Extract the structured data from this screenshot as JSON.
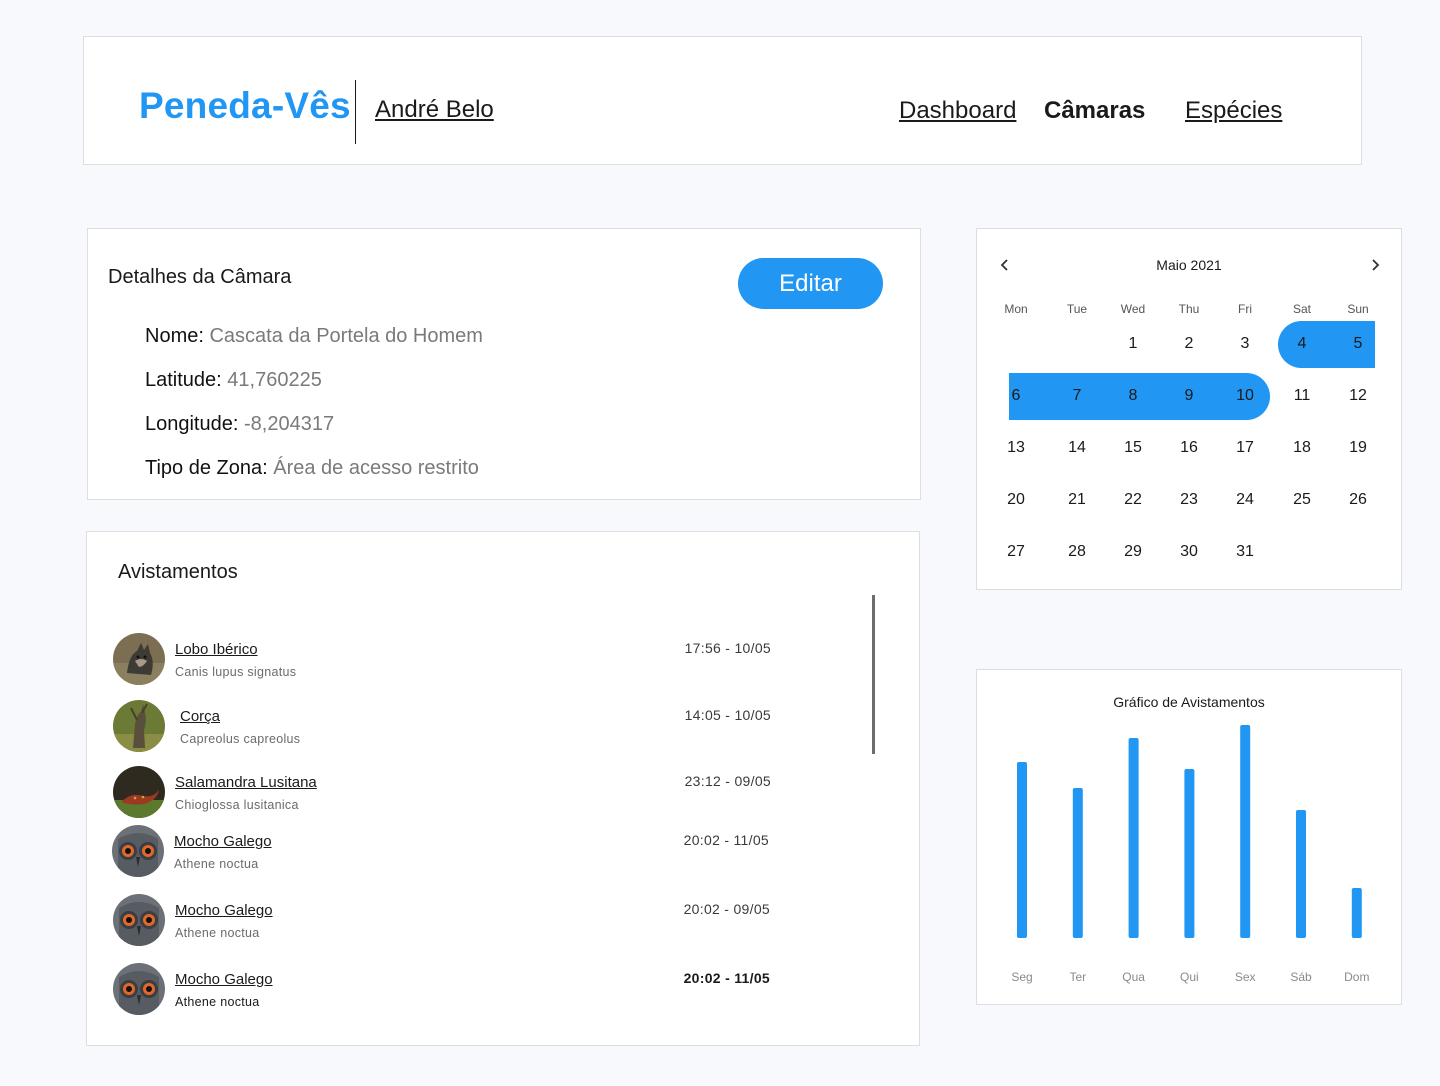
{
  "header": {
    "brand": "Peneda-Vês",
    "user": "André Belo",
    "nav": [
      {
        "label": "Dashboard",
        "active": false
      },
      {
        "label": "Câmaras",
        "active": true
      },
      {
        "label": "Espécies",
        "active": false
      }
    ]
  },
  "details": {
    "title": "Detalhes da Câmara",
    "edit_label": "Editar",
    "fields": [
      {
        "label": "Nome:",
        "value": "Cascata da Portela do Homem"
      },
      {
        "label": "Latitude:",
        "value": "41,760225"
      },
      {
        "label": "Longitude:",
        "value": "-8,204317"
      },
      {
        "label": "Tipo de Zona:",
        "value": "Área de acesso restrito"
      }
    ]
  },
  "sightings": {
    "title": "Avistamentos",
    "items": [
      {
        "name": "Lobo Ibérico",
        "scientific": "Canis lupus signatus",
        "time": "17:56 - 10/05",
        "avatar": "wolf"
      },
      {
        "name": "Corça",
        "scientific": "Capreolus capreolus",
        "time": "14:05 - 10/05",
        "avatar": "deer"
      },
      {
        "name": "Salamandra Lusitana",
        "scientific": "Chioglossa lusitanica",
        "time": "23:12 - 09/05",
        "avatar": "salamander"
      },
      {
        "name": "Mocho Galego",
        "scientific": "Athene noctua",
        "time": "20:02 - 11/05",
        "avatar": "owl"
      },
      {
        "name": "Mocho Galego",
        "scientific": "Athene noctua",
        "time": "20:02 - 09/05",
        "avatar": "owl"
      },
      {
        "name": "Mocho Galego",
        "scientific": "Athene noctua",
        "time": "20:02 - 11/05",
        "avatar": "owl"
      }
    ]
  },
  "calendar": {
    "title": "Maio 2021",
    "weekdays": [
      "Mon",
      "Tue",
      "Wed",
      "Thu",
      "Fri",
      "Sat",
      "Sun"
    ],
    "first_weekday_index": 2,
    "days_in_month": 31,
    "selected_range": [
      4,
      10
    ],
    "accent": "#2196f3"
  },
  "chart": {
    "title": "Gráfico de Avistamentos",
    "chart_data": {
      "type": "bar",
      "title": "Gráfico de Avistamentos",
      "categories": [
        "Seg",
        "Ter",
        "Qua",
        "Qui",
        "Sex",
        "Sáb",
        "Dom"
      ],
      "values": [
        176,
        150,
        200,
        169,
        213,
        128,
        50
      ],
      "ylim": [
        0,
        213
      ],
      "color": "#2196f3",
      "grid": false,
      "xlabel": "",
      "ylabel": ""
    }
  }
}
